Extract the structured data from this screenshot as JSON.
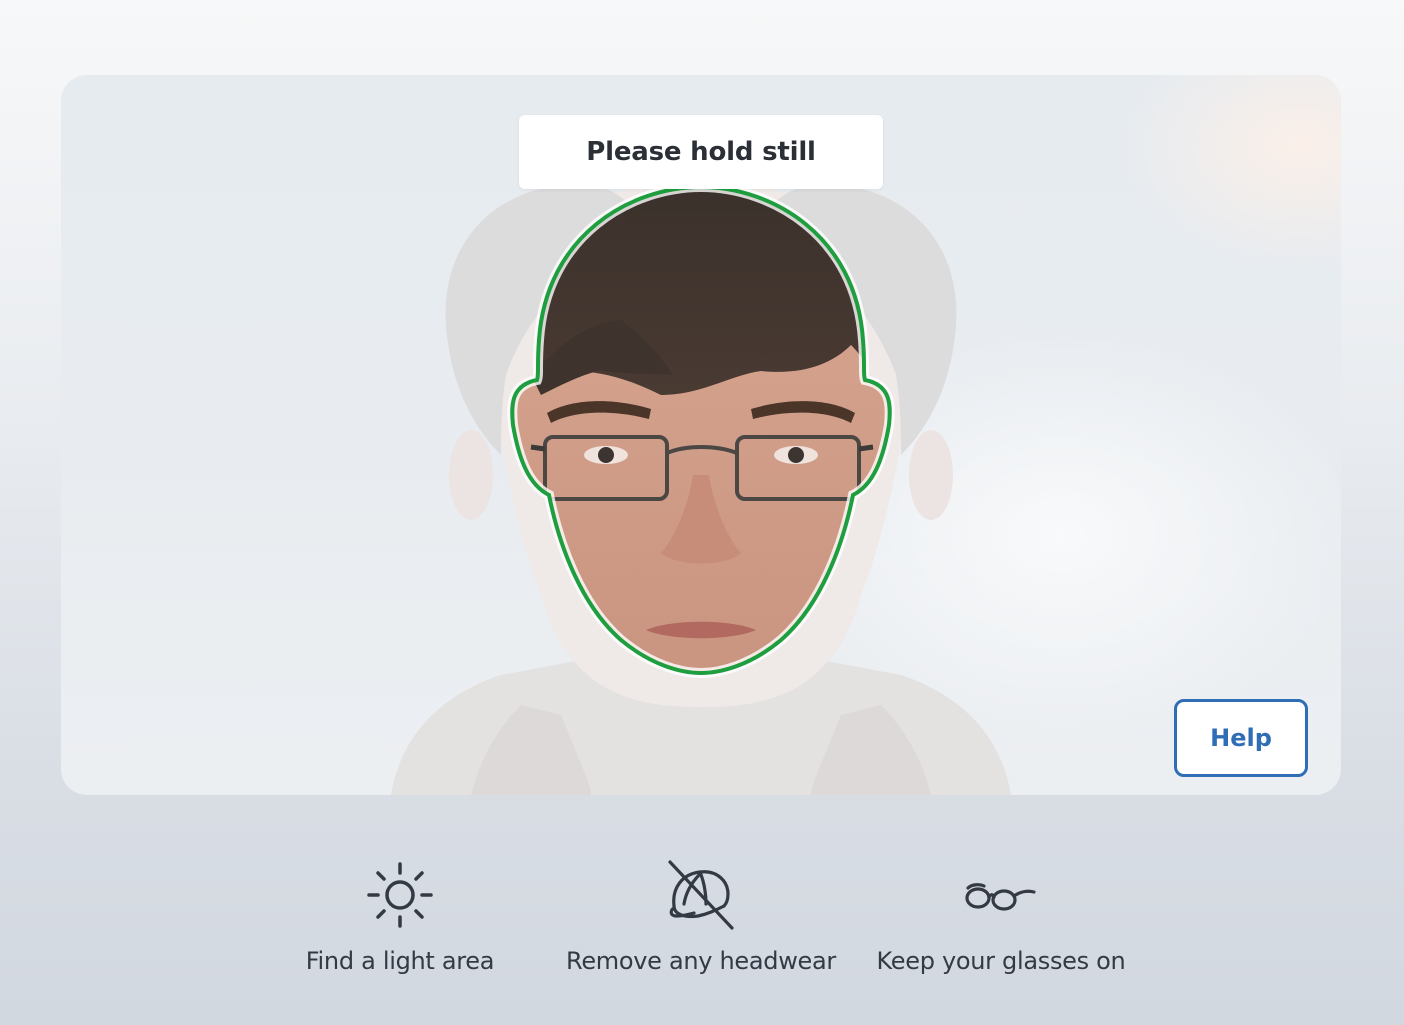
{
  "camera": {
    "prompt_text": "Please hold still",
    "help_label": "Help",
    "outline_color": "#1e9e3e"
  },
  "tips": [
    {
      "icon": "sun-icon",
      "label": "Find a light area"
    },
    {
      "icon": "no-headwear-icon",
      "label": "Remove any headwear"
    },
    {
      "icon": "glasses-icon",
      "label": "Keep your glasses on"
    }
  ],
  "colors": {
    "accent": "#2f6db5",
    "icon": "#343a44",
    "text": "#343a44"
  }
}
